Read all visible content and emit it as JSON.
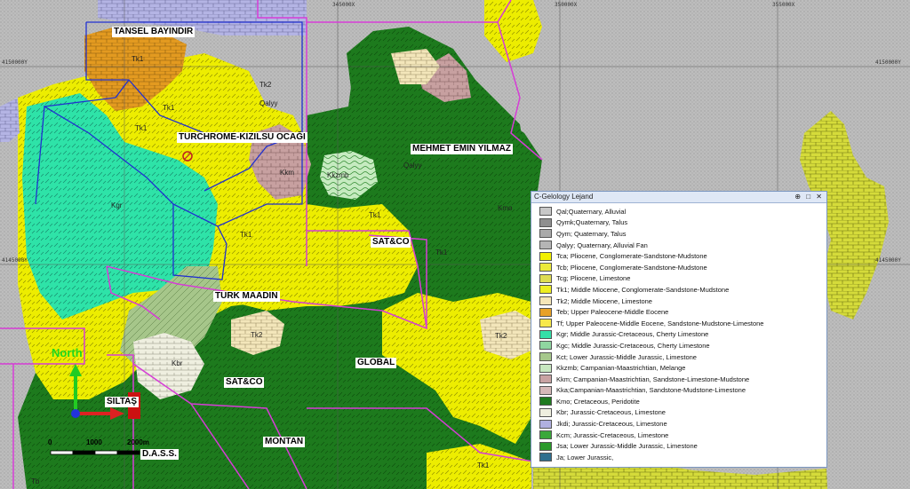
{
  "map_labels": {
    "tansel": "TANSEL BAYINDIR",
    "turchrome": "TURCHROME-KIZILSU OCAĞI",
    "mehmet": "MEHMET EMIN YILMAZ",
    "satco1": "SAT&CO",
    "turk_maadin": "TURK MAADIN",
    "global": "GLOBAL",
    "satco2": "SAT&CO",
    "siltas": "SILTAŞ",
    "montan": "MONTAN",
    "dass": "D.A.S.S."
  },
  "unit_labels": [
    "Tk1",
    "Tk1",
    "Tk2",
    "Tk1",
    "Kgr",
    "Kmo",
    "Kkm",
    "Kkzmb",
    "Qalyy",
    "Qalyy",
    "Tk1",
    "Tk2",
    "Tk2",
    "Tk1",
    "Kbr",
    "Tk1",
    "Tk1",
    "Tb"
  ],
  "coords": {
    "y1": "4150000Y",
    "y2": "4150000Y",
    "y3": "4145000Y",
    "y4": "4145000Y",
    "x1": "345000X",
    "x2": "350000X",
    "x3": "355000X"
  },
  "scale_bar": {
    "t0": "0",
    "t1": "1000",
    "t2": "2000m"
  },
  "north_label": "North",
  "legend": {
    "title": "C-Gelology Lejand",
    "controls": "⊕ □ ✕",
    "items": [
      {
        "label": "Qal;Quaternary,  Alluvial",
        "color": "#c8c8c8"
      },
      {
        "label": "Qymk;Quaternary, Talus",
        "color": "#8f8f8f"
      },
      {
        "label": "Qym; Quaternary, Talus",
        "color": "#a9a9a9"
      },
      {
        "label": "Qalyy; Quaternary, Alluvial Fan",
        "color": "#b5b5b5"
      },
      {
        "label": "Tca;  Pliocene, Conglomerate-Sandstone-Mudstone",
        "color": "#f2f000"
      },
      {
        "label": "Tcb; Pliocene, Conglomerate-Sandstone-Mudstone",
        "color": "#ecea3a"
      },
      {
        "label": "Tcg;  Pliocene, Limestone",
        "color": "#dedc52"
      },
      {
        "label": "Tk1; Middle Miocene, Conglomerate-Sandstone-Mudstone",
        "color": "#eeee22"
      },
      {
        "label": "Tk2; Middle Miocene, Limestone",
        "color": "#f5e6b8"
      },
      {
        "label": "Teb; Upper Paleocene-Middle Eocene",
        "color": "#e8a126"
      },
      {
        "label": "Tf; Upper Paleocene-Middle Eocene, Sandstone-Mudstone-Limestone",
        "color": "#f7e84a"
      },
      {
        "label": "Kgr; Middle Jurassic-Cretaceous, Cherty Limestone",
        "color": "#33e0a8"
      },
      {
        "label": "Kgc; Middle Jurassic-Cretaceous, Cherty Limestone",
        "color": "#8fd6a0"
      },
      {
        "label": "Kct; Lower Jurassic-Middle Jurassic, Limestone",
        "color": "#a6c88c"
      },
      {
        "label": "Kkzmb; Campanian-Maastrichtian, Melange",
        "color": "#c8e8c0"
      },
      {
        "label": "Kkm; Campanian-Maastrichtian, Sandstone-Limestone-Mudstone",
        "color": "#c9a3a3"
      },
      {
        "label": "Kka;Campanian-Maastrichtian, Sandstone-Mudstone-Limestone",
        "color": "#d6b8b8"
      },
      {
        "label": "Kmo; Cretaceous, Peridotite",
        "color": "#1f7a1f"
      },
      {
        "label": "Kbr; Jurassic-Cretaceous, Limestone",
        "color": "#efefdf"
      },
      {
        "label": "Jkdi; Jurassic-Cretaceous, Limestone",
        "color": "#b0b0e0"
      },
      {
        "label": "Kcm; Jurassic-Cretaceous, Limestone",
        "color": "#3aa83a"
      },
      {
        "label": "Jsa; Lower Jurassic-Middle Jurassic, Limestone",
        "color": "#2a9a2a"
      },
      {
        "label": "Ja; Lower Jurassic,",
        "color": "#2e6f8e"
      }
    ]
  }
}
